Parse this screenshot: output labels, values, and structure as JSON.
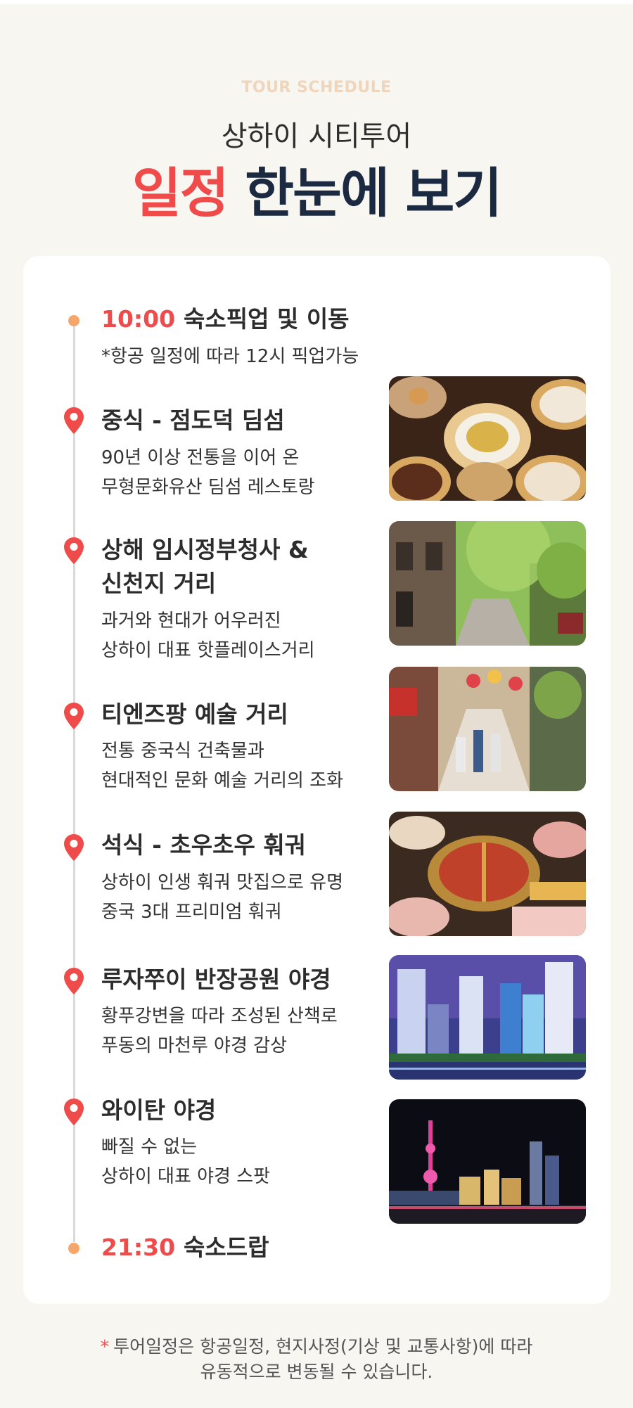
{
  "header": {
    "eyebrow": "TOUR SCHEDULE",
    "subtitle": "상하이 시티투어",
    "headline_accent": "일정",
    "headline_rest": "한눈에 보기"
  },
  "colors": {
    "accent": "#f04b4b",
    "navy": "#1b2a40",
    "dot": "#f6a66b",
    "background": "#f7f6f1"
  },
  "schedule": [
    {
      "time": "10:00",
      "title": "숙소픽업 및 이동",
      "desc": "*항공 일정에 따라 12시 픽업가능",
      "marker": "dot"
    },
    {
      "title": "중식 - 점도덕 딤섬",
      "desc": "90년 이상 전통을 이어 온\n무형문화유산 딤섬 레스토랑",
      "marker": "map-pin-icon",
      "image": "dim-sum-photo"
    },
    {
      "title": "상해 임시정부청사 &\n신천지 거리",
      "desc": "과거와 현대가 어우러진\n상하이 대표 핫플레이스거리",
      "marker": "map-pin-icon",
      "image": "xintiandi-street-photo"
    },
    {
      "title": "티엔즈팡 예술 거리",
      "desc": "전통 중국식 건축물과\n현대적인 문화 예술 거리의 조화",
      "marker": "map-pin-icon",
      "image": "tianzifang-alley-photo"
    },
    {
      "title": "석식 - 초우초우 훠궈",
      "desc": "상하이 인생 훠궈 맛집으로 유명\n중국 3대 프리미엄 훠궈",
      "marker": "map-pin-icon",
      "image": "hotpot-photo"
    },
    {
      "title": "루자쭈이 반장공원 야경",
      "desc": "황푸강변을 따라 조성된 산책로\n푸동의 마천루 야경 감상",
      "marker": "map-pin-icon",
      "image": "lujiazui-skyline-photo"
    },
    {
      "title": "와이탄 야경",
      "desc": "빠질 수 없는\n상하이 대표 야경 스팟",
      "marker": "map-pin-icon",
      "image": "bund-night-photo"
    },
    {
      "time": "21:30",
      "title": "숙소드랍",
      "marker": "dot"
    }
  ],
  "footnote": {
    "star": "*",
    "line1": "투어일정은 항공일정, 현지사정(기상 및 교통사항)에 따라",
    "line2": "유동적으로 변동될 수 있습니다."
  }
}
